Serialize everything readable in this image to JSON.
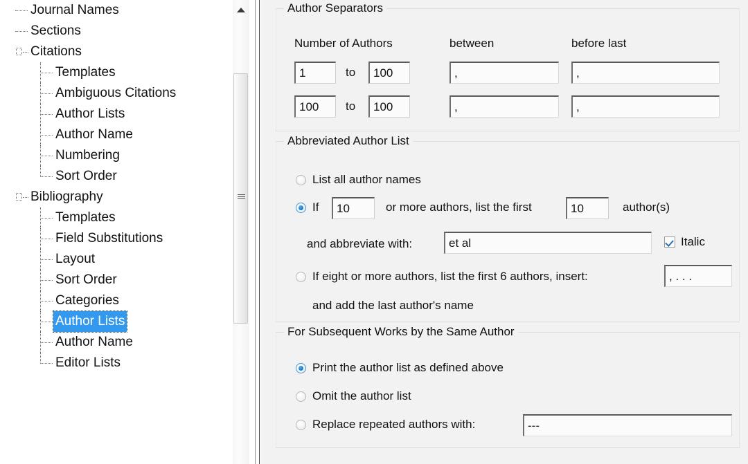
{
  "tree": {
    "items": [
      {
        "label": "Journal Names",
        "level": 1,
        "expandable": false,
        "selected": false
      },
      {
        "label": "Sections",
        "level": 1,
        "expandable": false,
        "selected": false
      },
      {
        "label": "Citations",
        "level": 1,
        "expandable": true,
        "selected": false
      },
      {
        "label": "Templates",
        "level": 2,
        "expandable": false,
        "selected": false
      },
      {
        "label": "Ambiguous Citations",
        "level": 2,
        "expandable": false,
        "selected": false
      },
      {
        "label": "Author Lists",
        "level": 2,
        "expandable": false,
        "selected": false
      },
      {
        "label": "Author Name",
        "level": 2,
        "expandable": false,
        "selected": false
      },
      {
        "label": "Numbering",
        "level": 2,
        "expandable": false,
        "selected": false
      },
      {
        "label": "Sort Order",
        "level": 2,
        "expandable": false,
        "selected": false
      },
      {
        "label": "Bibliography",
        "level": 1,
        "expandable": true,
        "selected": false
      },
      {
        "label": "Templates",
        "level": 2,
        "expandable": false,
        "selected": false
      },
      {
        "label": "Field Substitutions",
        "level": 2,
        "expandable": false,
        "selected": false
      },
      {
        "label": "Layout",
        "level": 2,
        "expandable": false,
        "selected": false
      },
      {
        "label": "Sort Order",
        "level": 2,
        "expandable": false,
        "selected": false
      },
      {
        "label": "Categories",
        "level": 2,
        "expandable": false,
        "selected": false
      },
      {
        "label": "Author Lists",
        "level": 2,
        "expandable": false,
        "selected": true
      },
      {
        "label": "Author Name",
        "level": 2,
        "expandable": false,
        "selected": false
      },
      {
        "label": "Editor Lists",
        "level": 2,
        "expandable": false,
        "selected": false
      }
    ],
    "selected_label": "Author Lists",
    "selection_color": "#3399ef"
  },
  "scrollbar": {
    "up_arrow": "scroll-up-arrow"
  },
  "author_separators": {
    "title": "Author Separators",
    "headers": {
      "number_of_authors": "Number of Authors",
      "between": "between",
      "before_last": "before last"
    },
    "to_word": "to",
    "rows": [
      {
        "from": "1",
        "to": "100",
        "between": ",",
        "before_last": ","
      },
      {
        "from": "100",
        "to": "100",
        "between": ",",
        "before_last": ","
      }
    ]
  },
  "abbreviated_author_list": {
    "title": "Abbreviated Author List",
    "option_all": {
      "label": "List all author names",
      "selected": false
    },
    "option_if": {
      "selected": true,
      "prefix": "If",
      "threshold": "10",
      "middle": "or more authors, list the first",
      "first_count": "10",
      "suffix": "author(s)"
    },
    "abbreviate": {
      "label": "and abbreviate with:",
      "value": "et al",
      "italic_label": "Italic",
      "italic_checked": true
    },
    "option_eight": {
      "selected": false,
      "label": "If eight or more authors, list the first 6 authors, insert:",
      "insert_value": ", . . .",
      "second_line": "and add the last author's name"
    }
  },
  "subsequent_works": {
    "title": "For Subsequent Works by the Same Author",
    "options": [
      {
        "label": "Print the author list as defined above",
        "selected": true
      },
      {
        "label": "Omit the author list",
        "selected": false
      },
      {
        "label": "Replace repeated authors with:",
        "selected": false
      }
    ],
    "replace_value": "---"
  }
}
